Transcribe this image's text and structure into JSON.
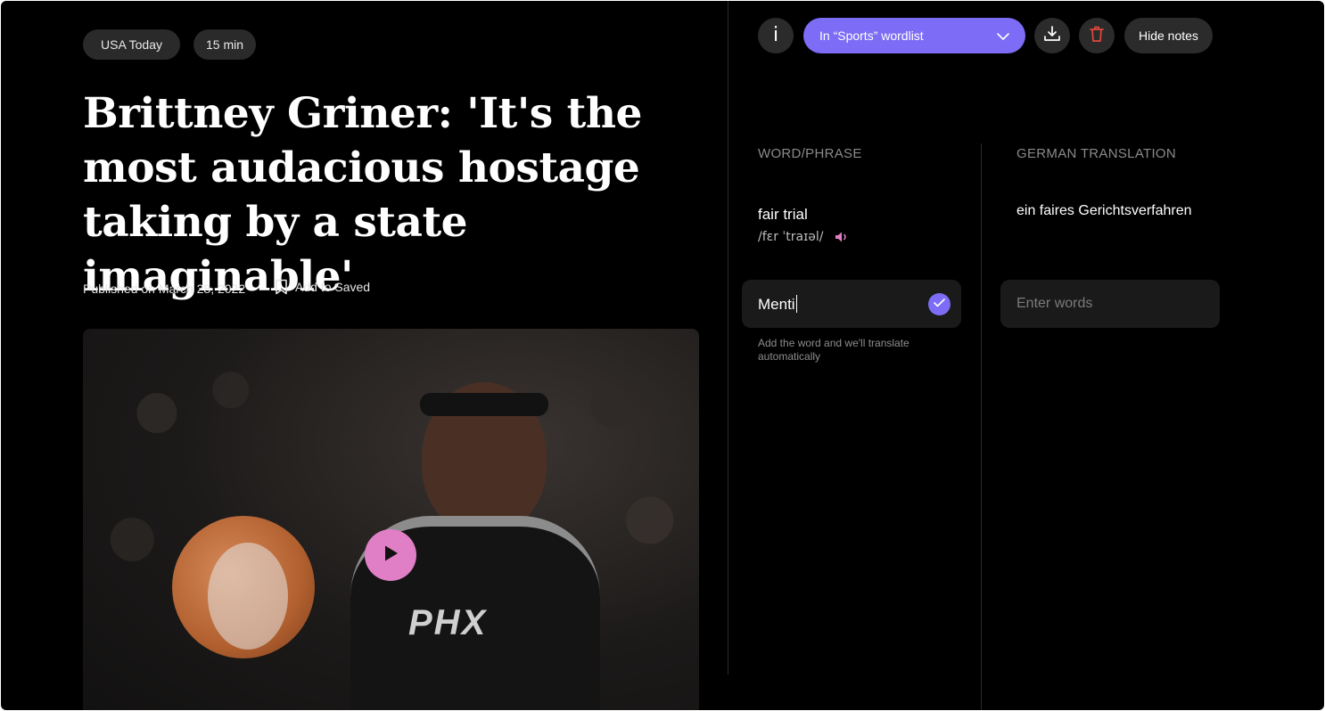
{
  "article": {
    "source": "USA Today",
    "duration": "15 min",
    "headline": "Brittney Griner: 'It's the most audacious hostage taking by a state imaginable'",
    "published": "Published on March 28, 2022",
    "save_label": "Add to Saved",
    "hero_jersey_text": "PHX"
  },
  "toolbar": {
    "info_glyph": "i",
    "wordlist_label": "In “Sports” wordlist",
    "hide_notes_label": "Hide notes"
  },
  "notes": {
    "col_word": "WORD/PHRASE",
    "col_translation": "GERMAN TRANSLATION",
    "entries": [
      {
        "word": "fair trial",
        "ipa": "/fɛr ˈtraɪəl/",
        "translation": "ein faires Gerichtsverfahren"
      }
    ],
    "new_word_value": "Menti",
    "translation_placeholder": "Enter words",
    "hint": "Add the word and we'll translate automatically"
  },
  "colors": {
    "background": "#000000",
    "accent": "#7d6cf5",
    "play_button": "#e07fc5",
    "delete_icon": "#e0483c",
    "speaker_icon": "#e07fc5"
  },
  "icons": [
    "info-icon",
    "chevron-down-icon",
    "download-icon",
    "trash-icon",
    "bookmark-icon",
    "play-icon",
    "speaker-icon",
    "check-icon"
  ]
}
